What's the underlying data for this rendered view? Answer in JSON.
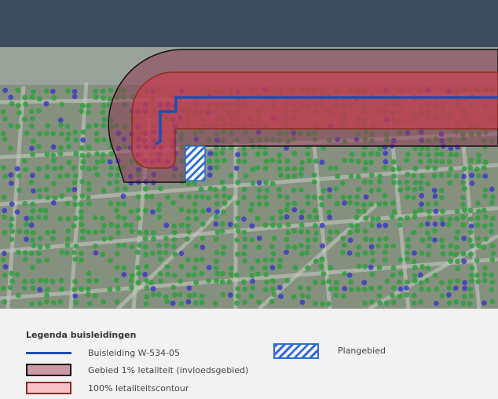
{
  "legend": {
    "title": "Legenda buisleidingen",
    "items": [
      {
        "key": "pipeline",
        "label": "Buisleiding W-534-05",
        "color": "#1f4fb0"
      },
      {
        "key": "influence",
        "label": "Gebied 1% letaliteit (invloedsgebied)",
        "fill": "#c99aa4",
        "stroke": "#111111"
      },
      {
        "key": "lethality",
        "label": "100% letaliteitscontour",
        "fill": "#f6c2c8",
        "stroke": "#8b2d1f"
      },
      {
        "key": "plan-area",
        "label": "Plangebied",
        "color": "#2f6fd1"
      }
    ]
  },
  "colors": {
    "sea": "#3c4c5c",
    "beach": "#9aa39a",
    "land": "#86907f",
    "road": "#c9ccc4",
    "tree_green": "#2fa040",
    "tree_blue": "#3a3ec0",
    "zone_1pct": "#8d3a55",
    "zone_100pct": "#d2394f",
    "pipeline": "#1f4fb0"
  }
}
